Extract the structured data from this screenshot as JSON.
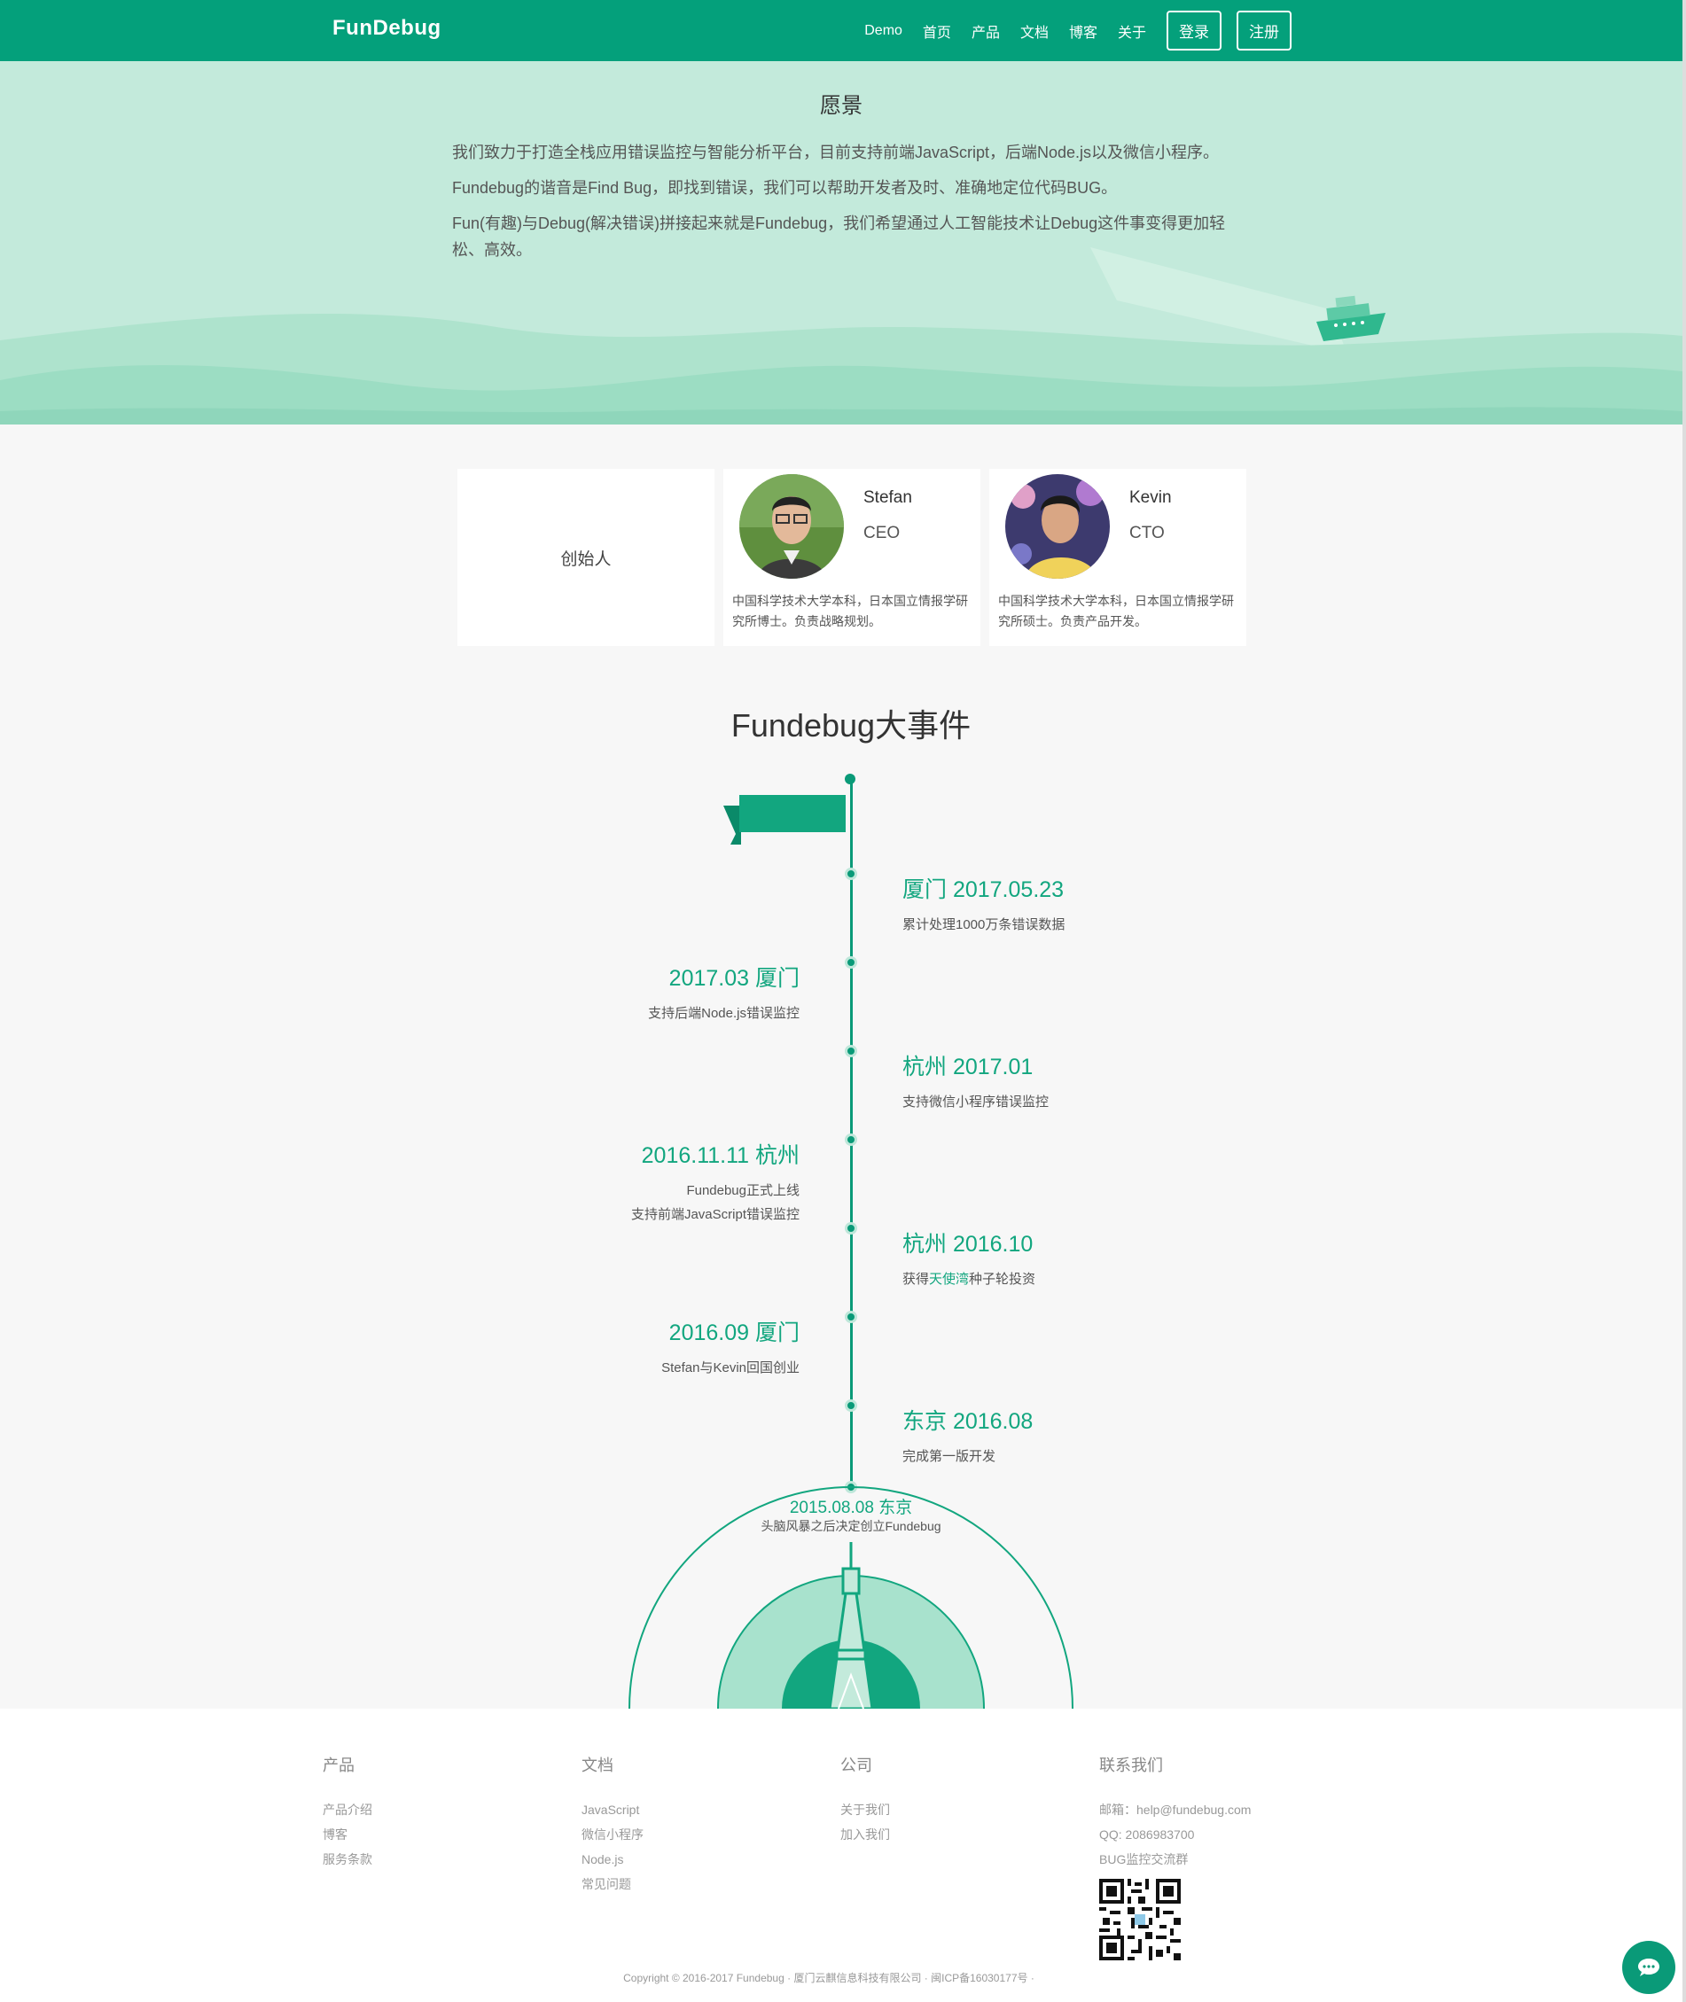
{
  "header": {
    "logo": "FunDebug",
    "nav": [
      "Demo",
      "首页",
      "产品",
      "文档",
      "博客",
      "关于"
    ],
    "login": "登录",
    "register": "注册"
  },
  "vision": {
    "title": "愿景",
    "paragraphs": [
      "我们致力于打造全栈应用错误监控与智能分析平台，目前支持前端JavaScript，后端Node.js以及微信小程序。",
      "Fundebug的谐音是Find Bug，即找到错误，我们可以帮助开发者及时、准确地定位代码BUG。",
      "Fun(有趣)与Debug(解决错误)拼接起来就是Fundebug，我们希望通过人工智能技术让Debug这件事变得更加轻松、高效。"
    ]
  },
  "founders": {
    "title": "创始人",
    "people": [
      {
        "name": "Stefan",
        "role": "CEO",
        "desc": "中国科学技术大学本科，日本国立情报学研究所博士。负责战略规划。"
      },
      {
        "name": "Kevin",
        "role": "CTO",
        "desc": "中国科学技术大学本科，日本国立情报学研究所硕士。负责产品开发。"
      }
    ]
  },
  "timeline": {
    "title": "Fundebug大事件",
    "events": [
      {
        "title": "厦门 2017.05.23",
        "desc": "累计处理1000万条错误数据"
      },
      {
        "title": "2017.03 厦门",
        "desc": "支持后端Node.js错误监控"
      },
      {
        "title": "杭州 2017.01",
        "desc": "支持微信小程序错误监控"
      },
      {
        "title": "2016.11.11 杭州",
        "desc1": "Fundebug正式上线",
        "desc2": "支持前端JavaScript错误监控"
      },
      {
        "title": "杭州 2016.10",
        "desc_pre": "获得",
        "desc_link": "天使湾",
        "desc_post": "种子轮投资"
      },
      {
        "title": "2016.09 厦门",
        "desc": "Stefan与Kevin回国创业"
      },
      {
        "title": "东京 2016.08",
        "desc": "完成第一版开发"
      }
    ],
    "root_title": "2015.08.08 东京",
    "root_desc": "头脑风暴之后决定创立Fundebug"
  },
  "footer": {
    "product": {
      "title": "产品",
      "links": [
        "产品介绍",
        "博客",
        "服务条款"
      ]
    },
    "docs": {
      "title": "文档",
      "links": [
        "JavaScript",
        "微信小程序",
        "Node.js",
        "常见问题"
      ]
    },
    "company": {
      "title": "公司",
      "links": [
        "关于我们",
        "加入我们"
      ]
    },
    "contact": {
      "title": "联系我们",
      "email": "邮箱：help@fundebug.com",
      "qq": "QQ: 2086983700",
      "group": "BUG监控交流群"
    },
    "copyright": "Copyright © 2016-2017 Fundebug · 厦门云麒信息科技有限公司 · 闽ICP备16030177号 ·"
  },
  "colors": {
    "brand": "#04a07b",
    "accent": "#12a67f",
    "vision_bg": "#c3eadb"
  },
  "icons": [
    "chat-icon",
    "qr-code",
    "ship-illustration",
    "flag-illustration",
    "tower-illustration"
  ]
}
